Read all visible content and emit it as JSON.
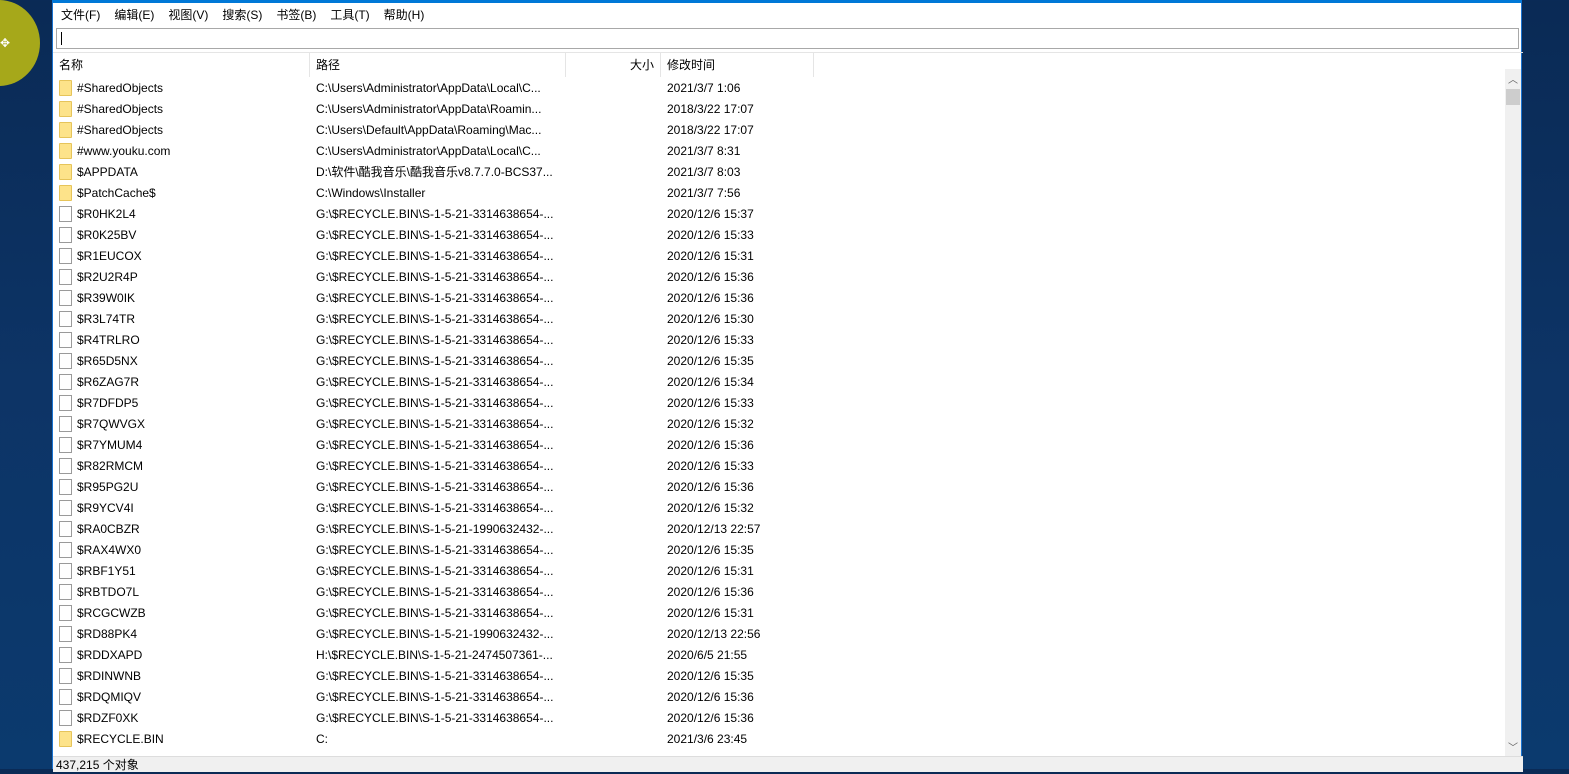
{
  "menu": [
    "文件(F)",
    "编辑(E)",
    "视图(V)",
    "搜索(S)",
    "书签(B)",
    "工具(T)",
    "帮助(H)"
  ],
  "search": {
    "value": ""
  },
  "columns": {
    "name": "名称",
    "path": "路径",
    "size": "大小",
    "modified": "修改时间"
  },
  "rows": [
    {
      "type": "folder",
      "name": "#SharedObjects",
      "path": "C:\\Users\\Administrator\\AppData\\Local\\C...",
      "size": "",
      "modified": "2021/3/7 1:06"
    },
    {
      "type": "folder",
      "name": "#SharedObjects",
      "path": "C:\\Users\\Administrator\\AppData\\Roamin...",
      "size": "",
      "modified": "2018/3/22 17:07"
    },
    {
      "type": "folder",
      "name": "#SharedObjects",
      "path": "C:\\Users\\Default\\AppData\\Roaming\\Mac...",
      "size": "",
      "modified": "2018/3/22 17:07"
    },
    {
      "type": "folder",
      "name": "#www.youku.com",
      "path": "C:\\Users\\Administrator\\AppData\\Local\\C...",
      "size": "",
      "modified": "2021/3/7 8:31"
    },
    {
      "type": "folder",
      "name": "$APPDATA",
      "path": "D:\\软件\\酷我音乐\\酷我音乐v8.7.7.0-BCS37...",
      "size": "",
      "modified": "2021/3/7 8:03"
    },
    {
      "type": "folder",
      "name": "$PatchCache$",
      "path": "C:\\Windows\\Installer",
      "size": "",
      "modified": "2021/3/7 7:56"
    },
    {
      "type": "file",
      "name": "$R0HK2L4",
      "path": "G:\\$RECYCLE.BIN\\S-1-5-21-3314638654-...",
      "size": "",
      "modified": "2020/12/6 15:37"
    },
    {
      "type": "file",
      "name": "$R0K25BV",
      "path": "G:\\$RECYCLE.BIN\\S-1-5-21-3314638654-...",
      "size": "",
      "modified": "2020/12/6 15:33"
    },
    {
      "type": "file",
      "name": "$R1EUCOX",
      "path": "G:\\$RECYCLE.BIN\\S-1-5-21-3314638654-...",
      "size": "",
      "modified": "2020/12/6 15:31"
    },
    {
      "type": "file",
      "name": "$R2U2R4P",
      "path": "G:\\$RECYCLE.BIN\\S-1-5-21-3314638654-...",
      "size": "",
      "modified": "2020/12/6 15:36"
    },
    {
      "type": "file",
      "name": "$R39W0IK",
      "path": "G:\\$RECYCLE.BIN\\S-1-5-21-3314638654-...",
      "size": "",
      "modified": "2020/12/6 15:36"
    },
    {
      "type": "file",
      "name": "$R3L74TR",
      "path": "G:\\$RECYCLE.BIN\\S-1-5-21-3314638654-...",
      "size": "",
      "modified": "2020/12/6 15:30"
    },
    {
      "type": "file",
      "name": "$R4TRLRO",
      "path": "G:\\$RECYCLE.BIN\\S-1-5-21-3314638654-...",
      "size": "",
      "modified": "2020/12/6 15:33"
    },
    {
      "type": "file",
      "name": "$R65D5NX",
      "path": "G:\\$RECYCLE.BIN\\S-1-5-21-3314638654-...",
      "size": "",
      "modified": "2020/12/6 15:35"
    },
    {
      "type": "file",
      "name": "$R6ZAG7R",
      "path": "G:\\$RECYCLE.BIN\\S-1-5-21-3314638654-...",
      "size": "",
      "modified": "2020/12/6 15:34"
    },
    {
      "type": "file",
      "name": "$R7DFDP5",
      "path": "G:\\$RECYCLE.BIN\\S-1-5-21-3314638654-...",
      "size": "",
      "modified": "2020/12/6 15:33"
    },
    {
      "type": "file",
      "name": "$R7QWVGX",
      "path": "G:\\$RECYCLE.BIN\\S-1-5-21-3314638654-...",
      "size": "",
      "modified": "2020/12/6 15:32"
    },
    {
      "type": "file",
      "name": "$R7YMUM4",
      "path": "G:\\$RECYCLE.BIN\\S-1-5-21-3314638654-...",
      "size": "",
      "modified": "2020/12/6 15:36"
    },
    {
      "type": "file",
      "name": "$R82RMCM",
      "path": "G:\\$RECYCLE.BIN\\S-1-5-21-3314638654-...",
      "size": "",
      "modified": "2020/12/6 15:33"
    },
    {
      "type": "file",
      "name": "$R95PG2U",
      "path": "G:\\$RECYCLE.BIN\\S-1-5-21-3314638654-...",
      "size": "",
      "modified": "2020/12/6 15:36"
    },
    {
      "type": "file",
      "name": "$R9YCV4I",
      "path": "G:\\$RECYCLE.BIN\\S-1-5-21-3314638654-...",
      "size": "",
      "modified": "2020/12/6 15:32"
    },
    {
      "type": "file",
      "name": "$RA0CBZR",
      "path": "G:\\$RECYCLE.BIN\\S-1-5-21-1990632432-...",
      "size": "",
      "modified": "2020/12/13 22:57"
    },
    {
      "type": "file",
      "name": "$RAX4WX0",
      "path": "G:\\$RECYCLE.BIN\\S-1-5-21-3314638654-...",
      "size": "",
      "modified": "2020/12/6 15:35"
    },
    {
      "type": "file",
      "name": "$RBF1Y51",
      "path": "G:\\$RECYCLE.BIN\\S-1-5-21-3314638654-...",
      "size": "",
      "modified": "2020/12/6 15:31"
    },
    {
      "type": "file",
      "name": "$RBTDO7L",
      "path": "G:\\$RECYCLE.BIN\\S-1-5-21-3314638654-...",
      "size": "",
      "modified": "2020/12/6 15:36"
    },
    {
      "type": "file",
      "name": "$RCGCWZB",
      "path": "G:\\$RECYCLE.BIN\\S-1-5-21-3314638654-...",
      "size": "",
      "modified": "2020/12/6 15:31"
    },
    {
      "type": "file",
      "name": "$RD88PK4",
      "path": "G:\\$RECYCLE.BIN\\S-1-5-21-1990632432-...",
      "size": "",
      "modified": "2020/12/13 22:56"
    },
    {
      "type": "file",
      "name": "$RDDXAPD",
      "path": "H:\\$RECYCLE.BIN\\S-1-5-21-2474507361-...",
      "size": "",
      "modified": "2020/6/5 21:55"
    },
    {
      "type": "file",
      "name": "$RDINWNB",
      "path": "G:\\$RECYCLE.BIN\\S-1-5-21-3314638654-...",
      "size": "",
      "modified": "2020/12/6 15:35"
    },
    {
      "type": "file",
      "name": "$RDQMIQV",
      "path": "G:\\$RECYCLE.BIN\\S-1-5-21-3314638654-...",
      "size": "",
      "modified": "2020/12/6 15:36"
    },
    {
      "type": "file",
      "name": "$RDZF0XK",
      "path": "G:\\$RECYCLE.BIN\\S-1-5-21-3314638654-...",
      "size": "",
      "modified": "2020/12/6 15:36"
    },
    {
      "type": "folder",
      "name": "$RECYCLE.BIN",
      "path": "C:",
      "size": "",
      "modified": "2021/3/6 23:45"
    }
  ],
  "status": "437,215 个对象",
  "colors": {
    "accent": "#0078d7",
    "folder": "#fde38a"
  }
}
